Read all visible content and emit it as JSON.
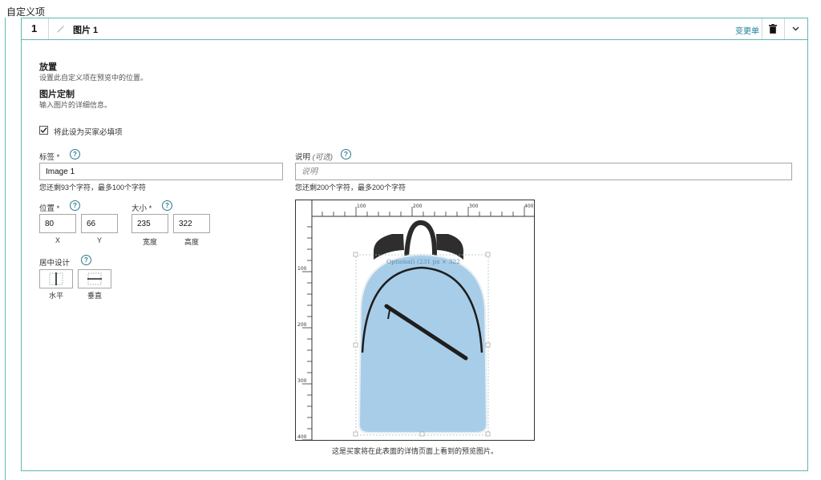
{
  "section": {
    "title": "自定义项"
  },
  "item": {
    "index": "1",
    "title": "图片 1",
    "change_label": "变更单",
    "icons": {
      "edit": "pencil-icon",
      "delete": "trash-icon",
      "collapse": "chevron-down-icon"
    }
  },
  "placement": {
    "heading": "放置",
    "description": "设置此自定义项在预览中的位置。"
  },
  "image_custom": {
    "heading": "图片定制",
    "description": "输入图片的详细信息。"
  },
  "required": {
    "label": "将此设为买家必填项",
    "checked": true
  },
  "label_field": {
    "label": "标签 *",
    "value": "Image 1",
    "counter": "您还剩93个字符，最多100个字符"
  },
  "desc_field": {
    "label": "说明",
    "optional": "(可选)",
    "placeholder": "说明",
    "counter": "您还剩200个字符，最多200个字符"
  },
  "position": {
    "label": "位置 *",
    "x": "80",
    "y": "66",
    "x_caption": "X",
    "y_caption": "Y"
  },
  "size": {
    "label": "大小 *",
    "width": "235",
    "height": "322",
    "width_caption": "宽度",
    "height_caption": "高度"
  },
  "centering": {
    "label": "居中设计",
    "horizontal": "水平",
    "vertical": "垂直"
  },
  "preview": {
    "ruler_top": [
      "100",
      "200",
      "300",
      "400"
    ],
    "ruler_left": [
      "100",
      "200",
      "300",
      "400"
    ],
    "overlay_text": "Optional) (231 px × 322",
    "caption": "这是买家将在此表面的详情页面上看到的预览图片。",
    "product_color": "#a8cde8"
  },
  "colors": {
    "accent": "#5fb7b3",
    "link": "#1b7f9d"
  }
}
